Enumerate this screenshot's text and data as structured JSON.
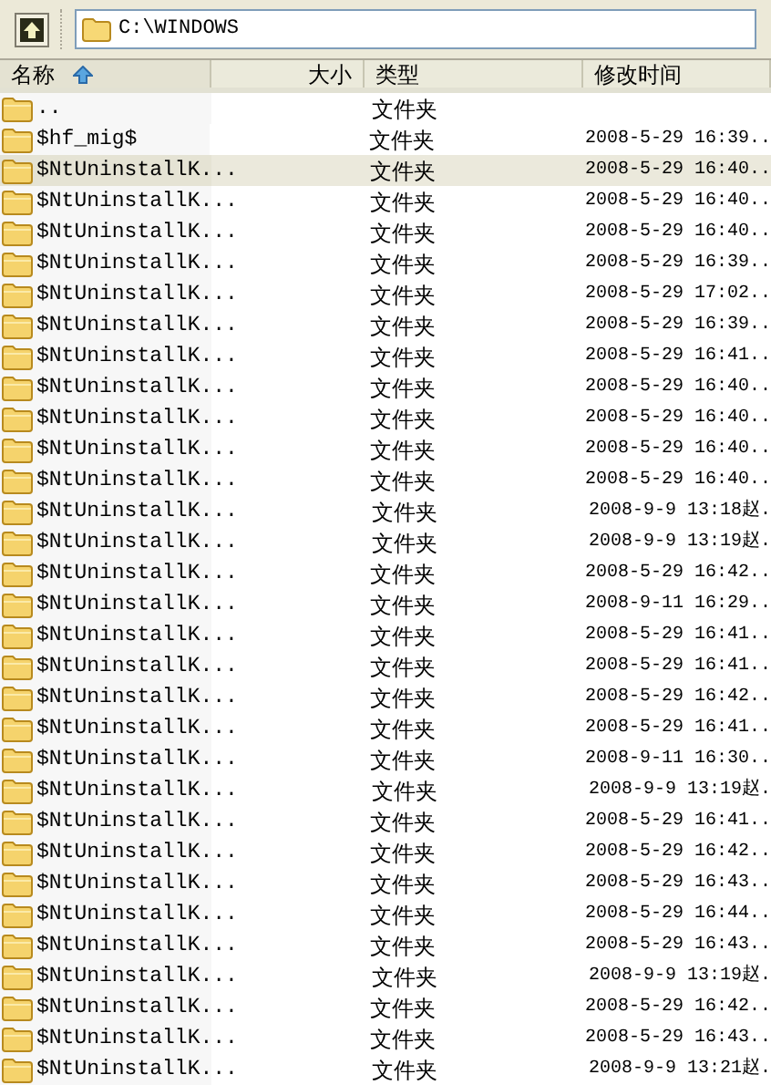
{
  "toolbar": {
    "address": "C:\\WINDOWS"
  },
  "columns": [
    {
      "label": "名称",
      "sorted": true
    },
    {
      "label": "大小",
      "sorted": false
    },
    {
      "label": "类型",
      "sorted": false
    },
    {
      "label": "修改时间",
      "sorted": false
    }
  ],
  "rows": [
    {
      "name": "..",
      "type": "文件夹",
      "selected": false
    },
    {
      "name": "$hf_mig$",
      "type": "文件夹",
      "modified": "2008-5-29 16:39..",
      "selected": false
    },
    {
      "name": "$NtUninstallK...",
      "type": "文件夹",
      "modified": "2008-5-29 16:40..",
      "selected": true
    },
    {
      "name": "$NtUninstallK...",
      "type": "文件夹",
      "modified": "2008-5-29 16:40..",
      "selected": false
    },
    {
      "name": "$NtUninstallK...",
      "type": "文件夹",
      "modified": "2008-5-29 16:40..",
      "selected": false
    },
    {
      "name": "$NtUninstallK...",
      "type": "文件夹",
      "modified": "2008-5-29 16:39..",
      "selected": false
    },
    {
      "name": "$NtUninstallK...",
      "type": "文件夹",
      "modified": "2008-5-29 17:02..",
      "selected": false
    },
    {
      "name": "$NtUninstallK...",
      "type": "文件夹",
      "modified": "2008-5-29 16:39..",
      "selected": false
    },
    {
      "name": "$NtUninstallK...",
      "type": "文件夹",
      "modified": "2008-5-29 16:41..",
      "selected": false
    },
    {
      "name": "$NtUninstallK...",
      "type": "文件夹",
      "modified": "2008-5-29 16:40..",
      "selected": false
    },
    {
      "name": "$NtUninstallK...",
      "type": "文件夹",
      "modified": "2008-5-29 16:40..",
      "selected": false
    },
    {
      "name": "$NtUninstallK...",
      "type": "文件夹",
      "modified": "2008-5-29 16:40..",
      "selected": false
    },
    {
      "name": "$NtUninstallK...",
      "type": "文件夹",
      "modified": "2008-5-29 16:40..",
      "selected": false
    },
    {
      "name": "$NtUninstallK...",
      "type": "文件夹",
      "modified": "2008-9-9 13:18赵.",
      "selected": false
    },
    {
      "name": "$NtUninstallK...",
      "type": "文件夹",
      "modified": "2008-9-9 13:19赵.",
      "selected": false
    },
    {
      "name": "$NtUninstallK...",
      "type": "文件夹",
      "modified": "2008-5-29 16:42..",
      "selected": false
    },
    {
      "name": "$NtUninstallK...",
      "type": "文件夹",
      "modified": "2008-9-11 16:29..",
      "selected": false
    },
    {
      "name": "$NtUninstallK...",
      "type": "文件夹",
      "modified": "2008-5-29 16:41..",
      "selected": false
    },
    {
      "name": "$NtUninstallK...",
      "type": "文件夹",
      "modified": "2008-5-29 16:41..",
      "selected": false
    },
    {
      "name": "$NtUninstallK...",
      "type": "文件夹",
      "modified": "2008-5-29 16:42..",
      "selected": false
    },
    {
      "name": "$NtUninstallK...",
      "type": "文件夹",
      "modified": "2008-5-29 16:41..",
      "selected": false
    },
    {
      "name": "$NtUninstallK...",
      "type": "文件夹",
      "modified": "2008-9-11 16:30..",
      "selected": false
    },
    {
      "name": "$NtUninstallK...",
      "type": "文件夹",
      "modified": "2008-9-9 13:19赵.",
      "selected": false
    },
    {
      "name": "$NtUninstallK...",
      "type": "文件夹",
      "modified": "2008-5-29 16:41..",
      "selected": false
    },
    {
      "name": "$NtUninstallK...",
      "type": "文件夹",
      "modified": "2008-5-29 16:42..",
      "selected": false
    },
    {
      "name": "$NtUninstallK...",
      "type": "文件夹",
      "modified": "2008-5-29 16:43..",
      "selected": false
    },
    {
      "name": "$NtUninstallK...",
      "type": "文件夹",
      "modified": "2008-5-29 16:44..",
      "selected": false
    },
    {
      "name": "$NtUninstallK...",
      "type": "文件夹",
      "modified": "2008-5-29 16:43..",
      "selected": false
    },
    {
      "name": "$NtUninstallK...",
      "type": "文件夹",
      "modified": "2008-9-9 13:19赵.",
      "selected": false
    },
    {
      "name": "$NtUninstallK...",
      "type": "文件夹",
      "modified": "2008-5-29 16:42..",
      "selected": false
    },
    {
      "name": "$NtUninstallK...",
      "type": "文件夹",
      "modified": "2008-5-29 16:43..",
      "selected": false
    },
    {
      "name": "$NtUninstallK...",
      "type": "文件夹",
      "modified": "2008-9-9 13:21赵.",
      "selected": false
    }
  ]
}
